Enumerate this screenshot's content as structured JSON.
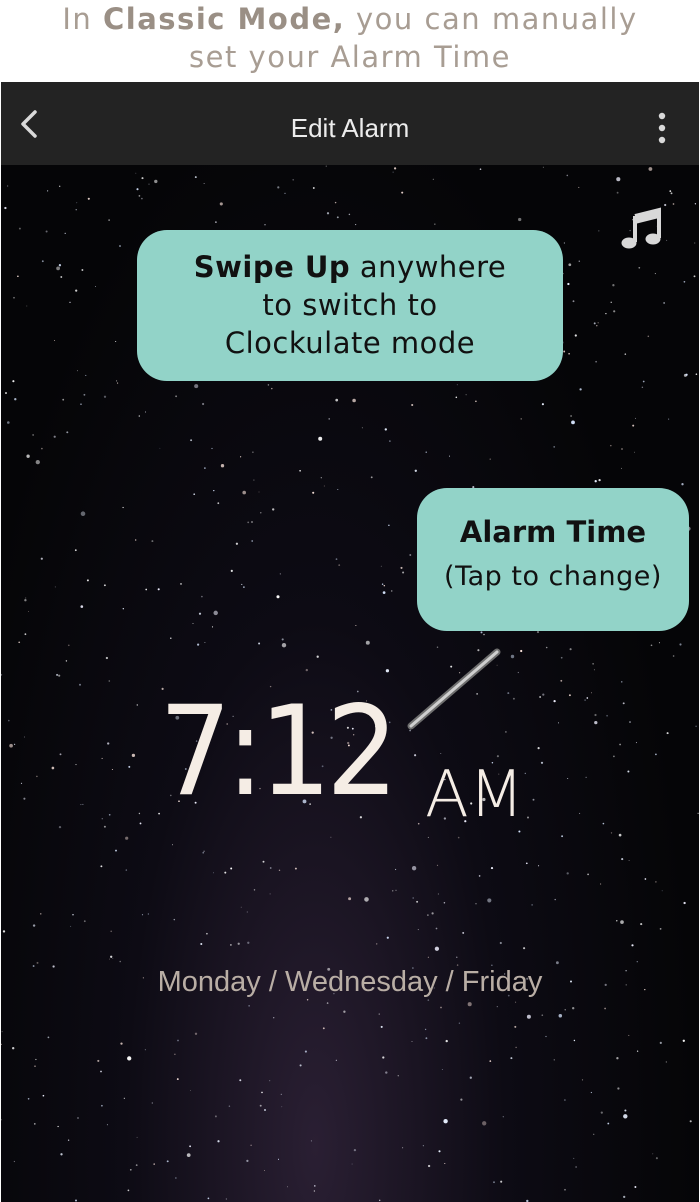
{
  "caption": {
    "prefix": "In ",
    "bold": "Classic Mode,",
    "suffix_line1": " you can manually",
    "line2": "set your Alarm Time"
  },
  "navbar": {
    "title": "Edit Alarm",
    "back_icon": "chevron-left-icon",
    "menu_icon": "vertical-dots-icon"
  },
  "music_icon": "music-note-icon",
  "bubble_swipe": {
    "bold": "Swipe Up",
    "rest_line1": " anywhere",
    "line2": "to switch to",
    "line3": "Clockulate mode"
  },
  "bubble_alarm": {
    "title": "Alarm Time",
    "subtitle": "(Tap to change)"
  },
  "alarm": {
    "time": "7:12",
    "ampm": "AM",
    "days": "Monday / Wednesday / Friday"
  },
  "colors": {
    "bubble": "#92d3c8",
    "navbar": "#232323",
    "time": "#f5ede5",
    "caption_text": "#a89d93"
  }
}
